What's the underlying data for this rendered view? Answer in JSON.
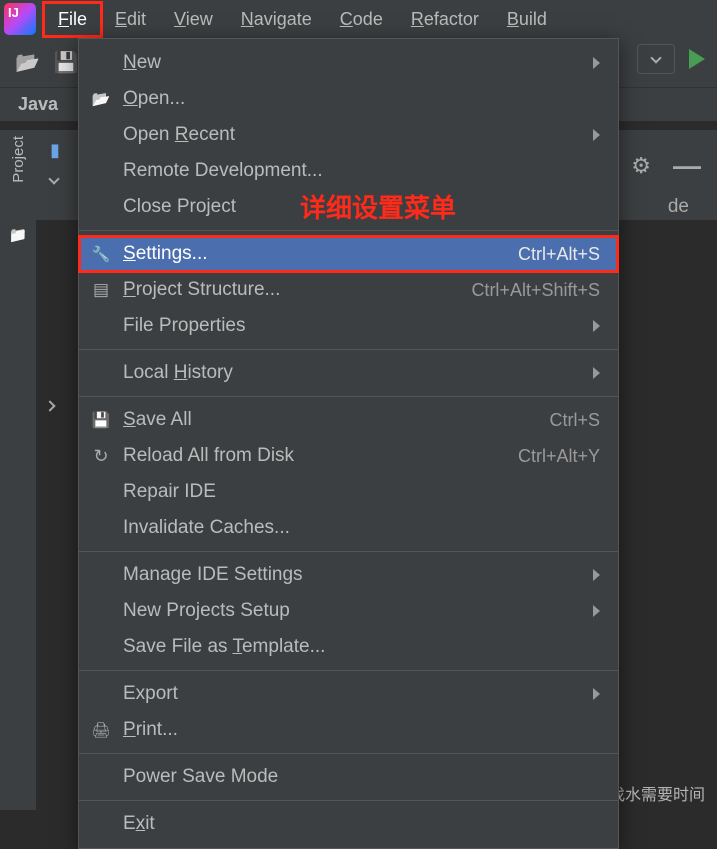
{
  "menubar": {
    "items": [
      {
        "label": "File",
        "underline": "F",
        "open": true
      },
      {
        "label": "Edit",
        "underline": "E"
      },
      {
        "label": "View",
        "underline": "V"
      },
      {
        "label": "Navigate",
        "underline": "N"
      },
      {
        "label": "Code",
        "underline": "C"
      },
      {
        "label": "Refactor",
        "underline": "R"
      },
      {
        "label": "Build",
        "underline": "B"
      }
    ]
  },
  "breadcrumb": "Java",
  "sidebar_label": "Project",
  "partial_editor_text": "de",
  "annotation_text": "详细设置菜单",
  "watermark": "CSDN @鱼找水需要时间",
  "file_menu": {
    "groups": [
      [
        {
          "label": "New",
          "underline": "N",
          "submenu": true
        },
        {
          "label": "Open...",
          "underline": "O",
          "icon": "open-ic"
        },
        {
          "label": "Open Recent",
          "underline": "R",
          "submenu": true
        },
        {
          "label": "Remote Development..."
        },
        {
          "label": "Close Project"
        }
      ],
      [
        {
          "label": "Settings...",
          "underline": "S",
          "icon": "wrench-ic",
          "shortcut": "Ctrl+Alt+S",
          "highlighted": true,
          "boxed": true
        },
        {
          "label": "Project Structure...",
          "underline": "P",
          "icon": "struct-ic",
          "shortcut": "Ctrl+Alt+Shift+S"
        },
        {
          "label": "File Properties",
          "submenu": true
        }
      ],
      [
        {
          "label": "Local History",
          "underline": "H",
          "submenu": true
        }
      ],
      [
        {
          "label": "Save All",
          "underline": "S",
          "icon": "save-ic",
          "shortcut": "Ctrl+S"
        },
        {
          "label": "Reload All from Disk",
          "icon": "reload-ic",
          "shortcut": "Ctrl+Alt+Y"
        },
        {
          "label": "Repair IDE"
        },
        {
          "label": "Invalidate Caches..."
        }
      ],
      [
        {
          "label": "Manage IDE Settings",
          "submenu": true
        },
        {
          "label": "New Projects Setup",
          "submenu": true
        },
        {
          "label": "Save File as Template...",
          "underline": "T"
        }
      ],
      [
        {
          "label": "Export",
          "submenu": true
        },
        {
          "label": "Print...",
          "underline": "P",
          "icon": "print-ic"
        }
      ],
      [
        {
          "label": "Power Save Mode"
        }
      ],
      [
        {
          "label": "Exit",
          "underline": "x"
        }
      ]
    ]
  }
}
